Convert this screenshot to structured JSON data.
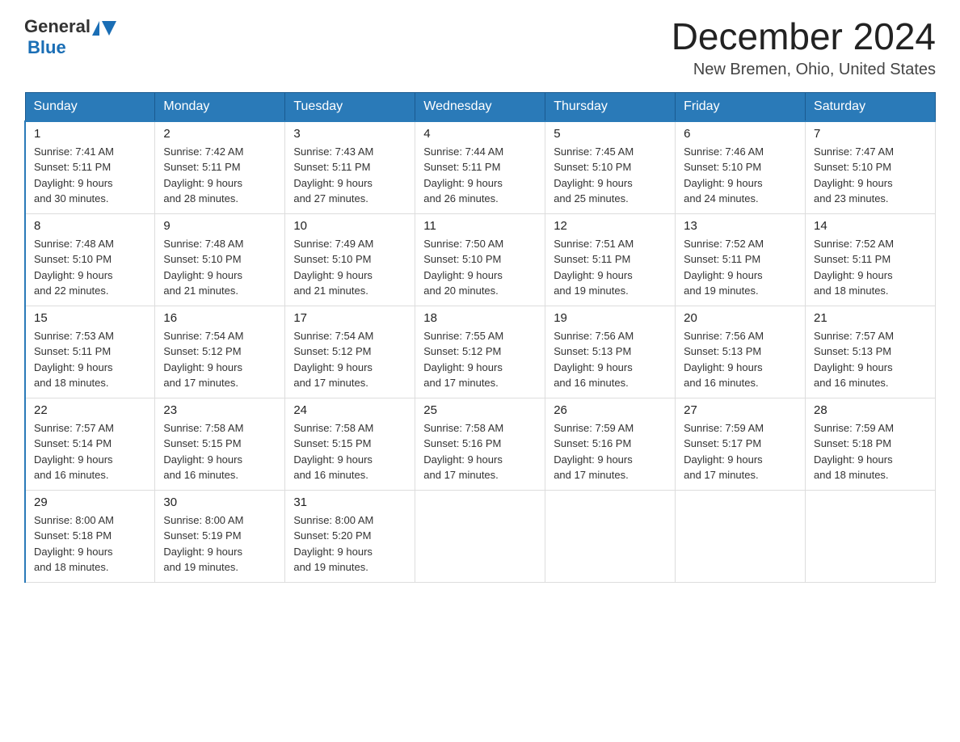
{
  "header": {
    "month_title": "December 2024",
    "location": "New Bremen, Ohio, United States",
    "logo_general": "General",
    "logo_blue": "Blue"
  },
  "weekdays": [
    "Sunday",
    "Monday",
    "Tuesday",
    "Wednesday",
    "Thursday",
    "Friday",
    "Saturday"
  ],
  "weeks": [
    [
      {
        "day": "1",
        "sunrise": "7:41 AM",
        "sunset": "5:11 PM",
        "daylight": "9 hours and 30 minutes."
      },
      {
        "day": "2",
        "sunrise": "7:42 AM",
        "sunset": "5:11 PM",
        "daylight": "9 hours and 28 minutes."
      },
      {
        "day": "3",
        "sunrise": "7:43 AM",
        "sunset": "5:11 PM",
        "daylight": "9 hours and 27 minutes."
      },
      {
        "day": "4",
        "sunrise": "7:44 AM",
        "sunset": "5:11 PM",
        "daylight": "9 hours and 26 minutes."
      },
      {
        "day": "5",
        "sunrise": "7:45 AM",
        "sunset": "5:10 PM",
        "daylight": "9 hours and 25 minutes."
      },
      {
        "day": "6",
        "sunrise": "7:46 AM",
        "sunset": "5:10 PM",
        "daylight": "9 hours and 24 minutes."
      },
      {
        "day": "7",
        "sunrise": "7:47 AM",
        "sunset": "5:10 PM",
        "daylight": "9 hours and 23 minutes."
      }
    ],
    [
      {
        "day": "8",
        "sunrise": "7:48 AM",
        "sunset": "5:10 PM",
        "daylight": "9 hours and 22 minutes."
      },
      {
        "day": "9",
        "sunrise": "7:48 AM",
        "sunset": "5:10 PM",
        "daylight": "9 hours and 21 minutes."
      },
      {
        "day": "10",
        "sunrise": "7:49 AM",
        "sunset": "5:10 PM",
        "daylight": "9 hours and 21 minutes."
      },
      {
        "day": "11",
        "sunrise": "7:50 AM",
        "sunset": "5:10 PM",
        "daylight": "9 hours and 20 minutes."
      },
      {
        "day": "12",
        "sunrise": "7:51 AM",
        "sunset": "5:11 PM",
        "daylight": "9 hours and 19 minutes."
      },
      {
        "day": "13",
        "sunrise": "7:52 AM",
        "sunset": "5:11 PM",
        "daylight": "9 hours and 19 minutes."
      },
      {
        "day": "14",
        "sunrise": "7:52 AM",
        "sunset": "5:11 PM",
        "daylight": "9 hours and 18 minutes."
      }
    ],
    [
      {
        "day": "15",
        "sunrise": "7:53 AM",
        "sunset": "5:11 PM",
        "daylight": "9 hours and 18 minutes."
      },
      {
        "day": "16",
        "sunrise": "7:54 AM",
        "sunset": "5:12 PM",
        "daylight": "9 hours and 17 minutes."
      },
      {
        "day": "17",
        "sunrise": "7:54 AM",
        "sunset": "5:12 PM",
        "daylight": "9 hours and 17 minutes."
      },
      {
        "day": "18",
        "sunrise": "7:55 AM",
        "sunset": "5:12 PM",
        "daylight": "9 hours and 17 minutes."
      },
      {
        "day": "19",
        "sunrise": "7:56 AM",
        "sunset": "5:13 PM",
        "daylight": "9 hours and 16 minutes."
      },
      {
        "day": "20",
        "sunrise": "7:56 AM",
        "sunset": "5:13 PM",
        "daylight": "9 hours and 16 minutes."
      },
      {
        "day": "21",
        "sunrise": "7:57 AM",
        "sunset": "5:13 PM",
        "daylight": "9 hours and 16 minutes."
      }
    ],
    [
      {
        "day": "22",
        "sunrise": "7:57 AM",
        "sunset": "5:14 PM",
        "daylight": "9 hours and 16 minutes."
      },
      {
        "day": "23",
        "sunrise": "7:58 AM",
        "sunset": "5:15 PM",
        "daylight": "9 hours and 16 minutes."
      },
      {
        "day": "24",
        "sunrise": "7:58 AM",
        "sunset": "5:15 PM",
        "daylight": "9 hours and 16 minutes."
      },
      {
        "day": "25",
        "sunrise": "7:58 AM",
        "sunset": "5:16 PM",
        "daylight": "9 hours and 17 minutes."
      },
      {
        "day": "26",
        "sunrise": "7:59 AM",
        "sunset": "5:16 PM",
        "daylight": "9 hours and 17 minutes."
      },
      {
        "day": "27",
        "sunrise": "7:59 AM",
        "sunset": "5:17 PM",
        "daylight": "9 hours and 17 minutes."
      },
      {
        "day": "28",
        "sunrise": "7:59 AM",
        "sunset": "5:18 PM",
        "daylight": "9 hours and 18 minutes."
      }
    ],
    [
      {
        "day": "29",
        "sunrise": "8:00 AM",
        "sunset": "5:18 PM",
        "daylight": "9 hours and 18 minutes."
      },
      {
        "day": "30",
        "sunrise": "8:00 AM",
        "sunset": "5:19 PM",
        "daylight": "9 hours and 19 minutes."
      },
      {
        "day": "31",
        "sunrise": "8:00 AM",
        "sunset": "5:20 PM",
        "daylight": "9 hours and 19 minutes."
      },
      null,
      null,
      null,
      null
    ]
  ]
}
